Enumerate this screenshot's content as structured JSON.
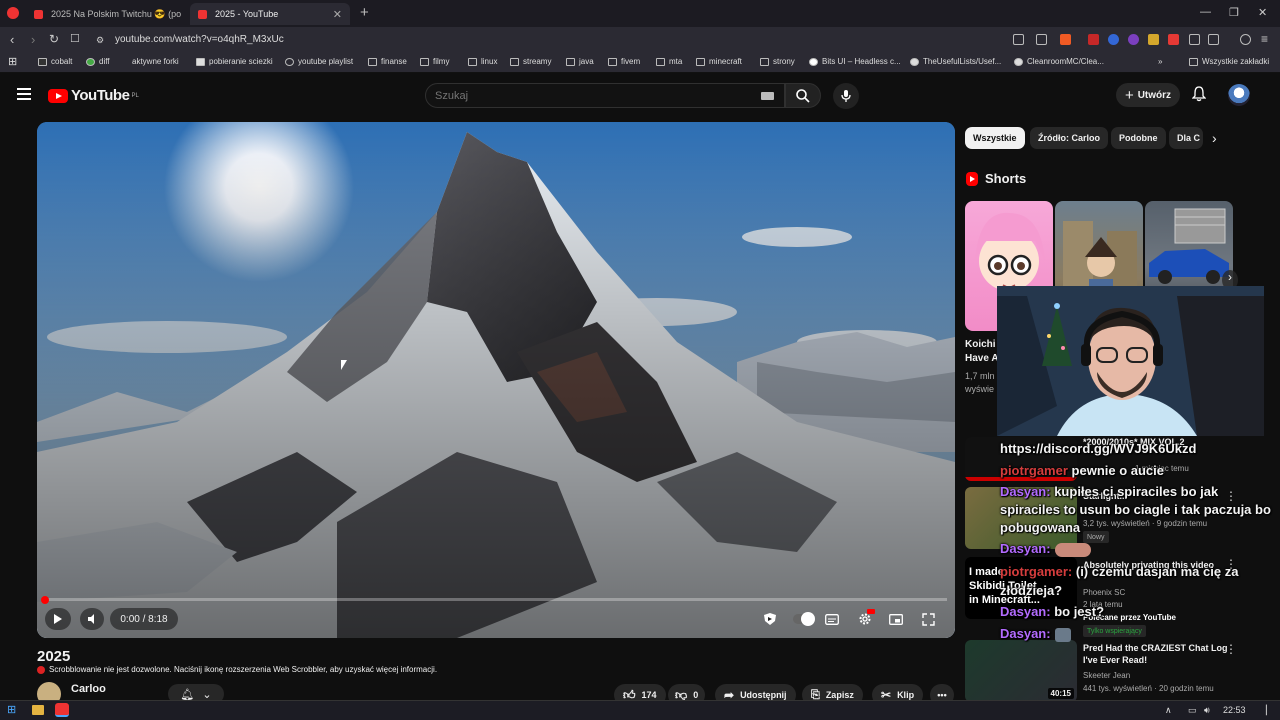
{
  "browser": {
    "tabs": [
      {
        "title": "2025 Na Polskim Twitchu 😎 (podsu"
      },
      {
        "title": "2025 - YouTube"
      }
    ],
    "url": "youtube.com/watch?v=o4qhR_M3xUc",
    "bookmarks": [
      "cobalt",
      "diff",
      "aktywne forki",
      "pobieranie sciezki",
      "youtube playlist",
      "finanse",
      "filmy",
      "linux",
      "streamy",
      "java",
      "fivem",
      "mta",
      "minecraft",
      "strony",
      "Bits UI – Headless c...",
      "TheUsefulLists/Usef...",
      "CleanroomMC/Clea...",
      "Wszystkie zakładki"
    ]
  },
  "youtube": {
    "logo": "YouTube",
    "region": "PL",
    "search_placeholder": "Szukaj",
    "create_label": "Utwórz"
  },
  "player": {
    "time": "0:00 / 8:18",
    "progress": 0
  },
  "video": {
    "title": "2025",
    "scrobbler_notice": "Scrobblowanie nie jest dozwolone. Naciśnij ikonę rozszerzenia Web Scrobbler, aby uzyskać więcej informacji.",
    "channel": "Carloo",
    "actions": {
      "likes": "174",
      "dislikes": "0",
      "share": "Udostępnij",
      "save": "Zapisz",
      "clip": "Klip"
    }
  },
  "sidebar": {
    "chips": [
      "Wszystkie",
      "Źródło: Carloo",
      "Podobne",
      "Dla C"
    ],
    "shorts_heading": "Shorts",
    "short1": {
      "title_line1": "Koichi",
      "title_line2": "Have A",
      "meta_line1": "1,7 mln",
      "meta_line2": "wyświe"
    },
    "recs": [
      {
        "title": "*2000/2010s* MIX VOL.2",
        "meta1": "",
        "meta2": "1 miesiąc temu",
        "badge": ""
      },
      {
        "title": "Starlight...",
        "meta1": "3,2 tys. wyświetleń · 9 godzin temu",
        "meta2": "",
        "badge": "Nowy"
      },
      {
        "title": "Absolutely privating this video",
        "meta1": "Phoenix SC",
        "meta2": "2 lata temu",
        "badge": "Polecane przez YouTube"
      },
      {
        "title": "Pred Had the CRAZIEST Chat Log I've Ever Read!",
        "meta1": "Skeeter Jean",
        "meta2": "441 tys. wyświetleń · 20 godzin temu",
        "badge": "Tylko wspierający"
      }
    ],
    "thumb_duration": "40:15",
    "thumb_text_skibidi": "I made Skibidi Toilet in Minecraft..."
  },
  "chat": [
    {
      "name": "",
      "msg": "https://discord.gg/WVJ9K6Ukzd"
    },
    {
      "name": "piotrgamer",
      "msg": "pewnie o aucie"
    },
    {
      "name": "Dasyan:",
      "msg": "kupiłes ci spiraciles bo jak"
    },
    {
      "name": "",
      "msg": "spiraciles to usun bo ciagle i tak paczuja bo"
    },
    {
      "name": "",
      "msg": "pobugowana"
    },
    {
      "name": "Dasyan:",
      "msg": ""
    },
    {
      "name": "piotrgamer:",
      "msg": "(i) czemu dasjan ma cię za"
    },
    {
      "name": "",
      "msg": "złodzieja?"
    },
    {
      "name": "Dasyan:",
      "msg": "bo jest?"
    },
    {
      "name": "Dasyan:",
      "msg": ""
    }
  ],
  "taskbar": {
    "time": "22:53"
  },
  "colors": {
    "accent": "#ff0000",
    "bg": "#0f0f0f",
    "chat_purple": "#b36bff",
    "chat_red": "#d63d3d"
  }
}
